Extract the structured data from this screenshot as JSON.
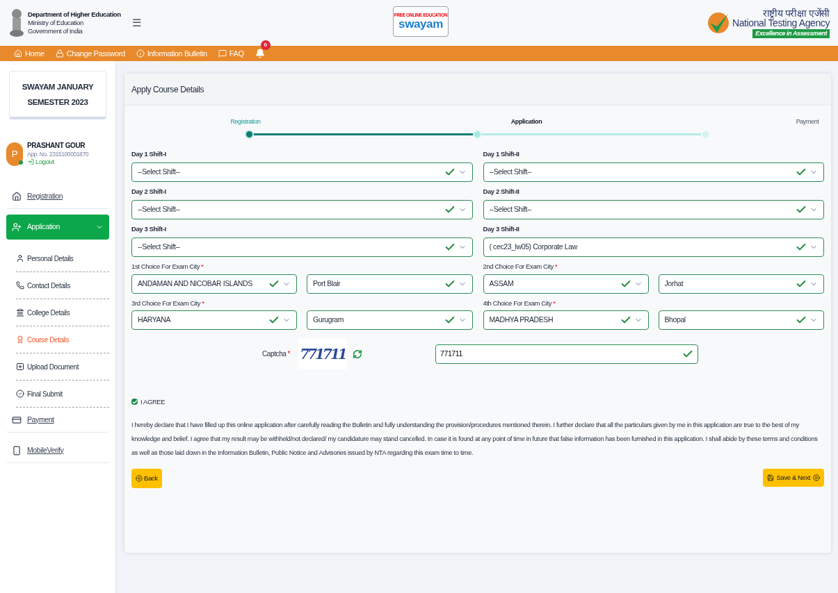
{
  "header": {
    "dept": {
      "title": "Department of Higher Education",
      "lines": [
        "Ministry of Education",
        "Government of India"
      ]
    },
    "menu_icon": "☰",
    "swayam": {
      "tagline": "FREE ONLINE EDUCATION",
      "name": "swayam"
    },
    "nta": {
      "hindi": "राष्ट्रीय परीक्षा एजेंसी",
      "name": "National Testing Agency",
      "motto": "Excellence in Assessment"
    }
  },
  "nav": {
    "items": [
      {
        "label": "Home"
      },
      {
        "label": "Change Password"
      },
      {
        "label": "Information Bulletin"
      },
      {
        "label": "FAQ"
      }
    ],
    "notifications": "0"
  },
  "sidebar": {
    "title": "SWAYAM JANUARY SEMESTER 2023",
    "user": {
      "initial": "P",
      "name": "PRASHANT GOUR",
      "app_no": "App. No. 2315100001870",
      "logout": "Logout"
    },
    "items": [
      {
        "label": "Registration",
        "selected": false
      },
      {
        "label": "Application",
        "selected": true,
        "children": [
          {
            "label": "Personal Details",
            "selected": false
          },
          {
            "label": "Contact Details",
            "selected": false
          },
          {
            "label": "College Details",
            "selected": false
          },
          {
            "label": "Course Details",
            "selected": true
          },
          {
            "label": "Upload Document",
            "selected": false
          },
          {
            "label": "Final Submit",
            "selected": false
          }
        ]
      },
      {
        "label": "Payment",
        "selected": false
      },
      {
        "label": "MobileVerify",
        "selected": false
      }
    ]
  },
  "card": {
    "title": "Apply Course Details",
    "steps": [
      {
        "label": "Registration",
        "completed": true,
        "selected": false
      },
      {
        "label": "Application",
        "completed": false,
        "selected": true
      },
      {
        "label": "Payment",
        "completed": false,
        "selected": false
      }
    ],
    "shift_fields": [
      {
        "label": "Day 1 Shift-I",
        "value": "--Select Shift--",
        "valid": true
      },
      {
        "label": "Day 1 Shift-II",
        "value": "--Select Shift--",
        "valid": true
      },
      {
        "label": "Day 2 Shift-I",
        "value": "--Select Shift--",
        "valid": true
      },
      {
        "label": "Day 2 Shift-II",
        "value": "--Select Shift--",
        "valid": true
      },
      {
        "label": "Day 3 Shift-I",
        "value": "--Select Shift--",
        "valid": true
      },
      {
        "label": "Day 3 Shift-II",
        "value": "( cec23_lw05) Corporate Law",
        "valid": true
      }
    ],
    "city_choices": [
      {
        "label": "1st Choice For Exam City",
        "required_mark": "*",
        "state": "ANDAMAN AND NICOBAR ISLANDS",
        "city": "Port Blair"
      },
      {
        "label": "2nd Choice For Exam City",
        "required_mark": "*",
        "state": "ASSAM",
        "city": "Jorhat"
      },
      {
        "label": "3rd Choice For Exam City",
        "required_mark": "*",
        "state": "HARYANA",
        "city": "Gurugram"
      },
      {
        "label": "4th Choice For Exam City",
        "required_mark": "*",
        "state": "MADHYA PRADESH",
        "city": "Bhopal"
      }
    ],
    "captcha": {
      "label": "Captcha",
      "required_mark": "*",
      "image_text": "771711",
      "value": "771711",
      "valid": true
    },
    "agree": {
      "label": "I AGREE",
      "checked": true
    },
    "declaration": "I hereby declare that I have filled up this online application after carefully reading the Bulletin and fully understanding the provision/procedures mentioned therein. I further declare that all the particulars given by me in this application are true to the best of my knowledge and belief. I agree that my result may be withheld/not declared/ my candidature may stand cancelled. In case it is found at any point of time in future that false information has been furnished in this application. I shall abide by these terms and conditions as well as those laid down in the Information Bulletin, Public Notice and Advisories issued by NTA regarding this exam time to time.",
    "back": "Back",
    "save": "Save & Next"
  }
}
